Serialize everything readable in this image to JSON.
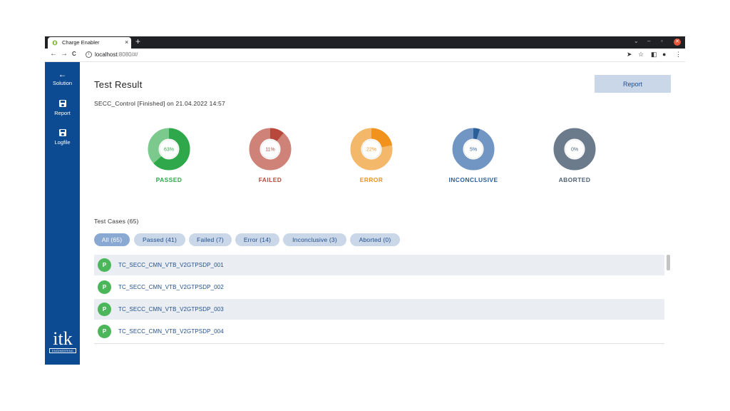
{
  "browser": {
    "tab_title": "Charge Enabler",
    "tab_close": "×",
    "new_tab": "+",
    "url_host": "localhost",
    "url_path": ":8080/#/",
    "back": "←",
    "forward": "→",
    "reload": "C"
  },
  "sidebar": {
    "items": [
      {
        "label": "Solution",
        "icon": "arrow-left-icon"
      },
      {
        "label": "Report",
        "icon": "floppy-icon"
      },
      {
        "label": "Logfile",
        "icon": "floppy-icon"
      }
    ],
    "logo_text": "itk",
    "logo_sub": "ENGINEERING"
  },
  "header": {
    "title": "Test Result",
    "report_button": "Report",
    "subtitle": "SECC_Control [Finished] on 21.04.2022 14:57"
  },
  "summary": [
    {
      "label": "PASSED",
      "percent": 63,
      "percent_text": "63%",
      "color": "#2ea84a",
      "light": "#7cc98d"
    },
    {
      "label": "FAILED",
      "percent": 11,
      "percent_text": "11%",
      "color": "#b8483c",
      "light": "#cf8277"
    },
    {
      "label": "ERROR",
      "percent": 22,
      "percent_text": "22%",
      "color": "#f0921c",
      "light": "#f4b86a"
    },
    {
      "label": "INCONCLUSIVE",
      "percent": 5,
      "percent_text": "5%",
      "color": "#2a5f98",
      "light": "#7196c4"
    },
    {
      "label": "ABORTED",
      "percent": 0,
      "percent_text": "0%",
      "color": "#4f6175",
      "light": "#6b7b8c"
    }
  ],
  "cases": {
    "title": "Test Cases (65)",
    "filters": [
      "All (65)",
      "Passed (41)",
      "Failed (7)",
      "Error (14)",
      "Inconclusive (3)",
      "Aborted (0)"
    ],
    "active_filter": 0,
    "rows": [
      {
        "status": "P",
        "name": "TC_SECC_CMN_VTB_V2GTPSDP_001"
      },
      {
        "status": "P",
        "name": "TC_SECC_CMN_VTB_V2GTPSDP_002"
      },
      {
        "status": "P",
        "name": "TC_SECC_CMN_VTB_V2GTPSDP_003"
      },
      {
        "status": "P",
        "name": "TC_SECC_CMN_VTB_V2GTPSDP_004"
      }
    ]
  }
}
